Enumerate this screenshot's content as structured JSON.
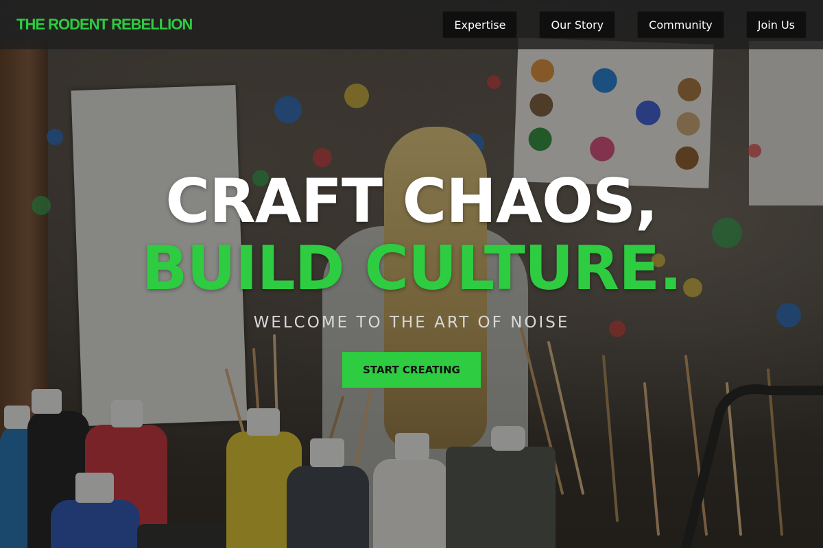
{
  "header": {
    "logo": "THE RODENT REBELLION",
    "nav": [
      {
        "label": "Expertise"
      },
      {
        "label": "Our Story"
      },
      {
        "label": "Community"
      },
      {
        "label": "Join Us"
      }
    ]
  },
  "hero": {
    "headline_line1": "CRAFT CHAOS,",
    "headline_line2": "BUILD CULTURE.",
    "tagline": "WELCOME TO THE ART OF NOISE",
    "cta_label": "START CREATING"
  },
  "colors": {
    "accent": "#2ecc40",
    "nav_button_bg": "#0f0f0f",
    "header_bg": "#1e1e1e"
  },
  "background": {
    "subject": "art-studio-photo"
  }
}
